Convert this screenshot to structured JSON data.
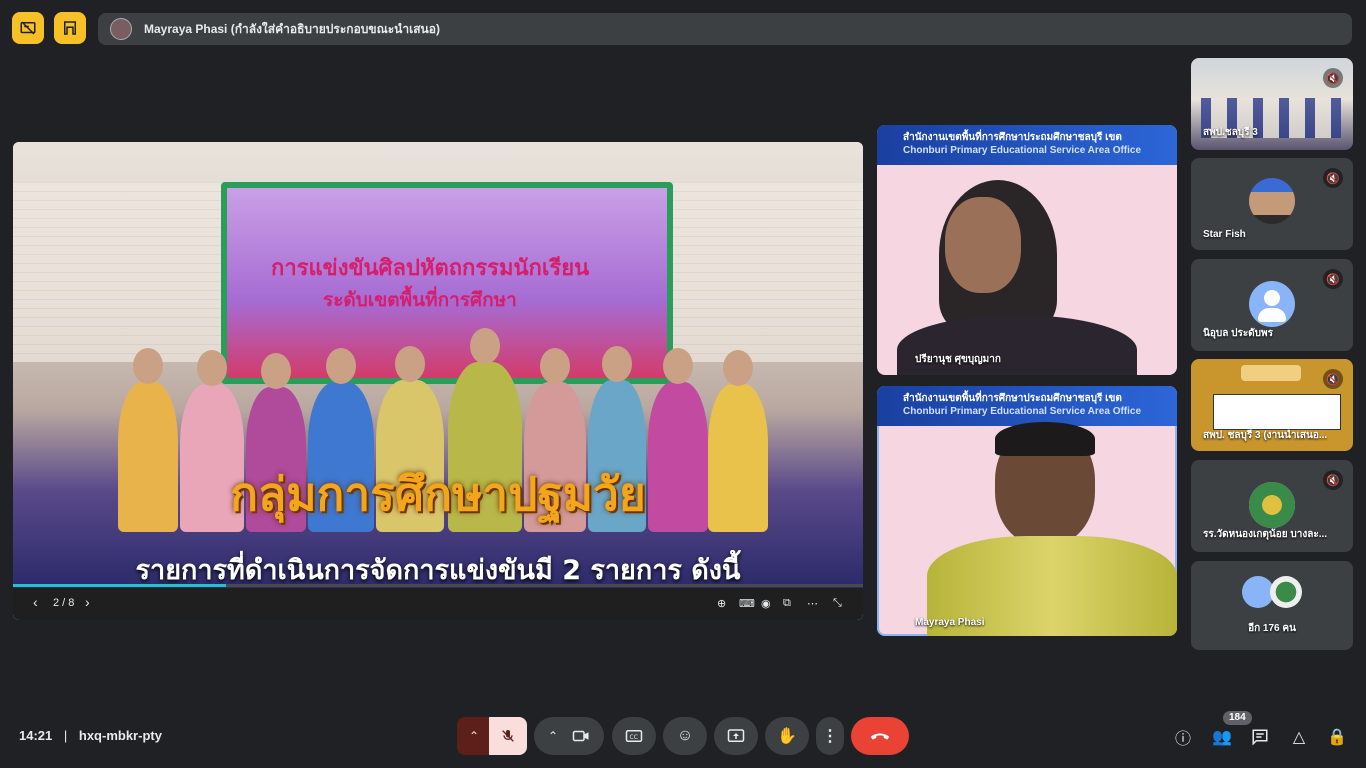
{
  "colors": {
    "accent": "#f6c026",
    "end_call": "#ea4335",
    "mic_off_bg": "#f9dedc",
    "tile_bg": "#3c4043",
    "page_bg": "#202124"
  },
  "top_bar": {
    "presenter_text": "Mayraya Phasi (กำลังใส่คำอธิบายประกอบขณะนำเสนอ)",
    "left_icons": [
      "present-stop-icon",
      "layout-icon"
    ]
  },
  "presentation": {
    "slide_banner_line1": "การแข่งขันศิลปหัตถกรรมนักเรียน",
    "slide_banner_line2": "ระดับเขตพื้นที่การศึกษา",
    "slide_headline": "กลุ่มการศึกษาปฐมวัย",
    "slide_subline": "รายการที่ดำเนินการจัดการแข่งขันมี 2 รายการ ดังนี้",
    "page_indicator": "2 / 8",
    "progress": 0.25
  },
  "video_tiles": {
    "header_line1": "สำนักงานเขตพื้นที่การศึกษาประถมศึกษาชลบุรี เขต",
    "header_line2": "Chonburi Primary Educational Service Area Office",
    "person1_name": "ปรียานุช ศุขบุญมาก",
    "person2_name": "Mayraya Phasi"
  },
  "participants": [
    {
      "name": "สพป.ชลบุรี 3",
      "type": "video"
    },
    {
      "name": "Star Fish",
      "type": "photo"
    },
    {
      "name": "นิอุบล ประดับพร",
      "type": "placeholder"
    },
    {
      "name": "สพป. ชลบุรี 3 (งานนำเสนอ...",
      "type": "presentation"
    },
    {
      "name": "รร.วัดหนองเกตุน้อย บางละ...",
      "type": "logo"
    },
    {
      "name": "อีก 176 คน",
      "type": "more"
    }
  ],
  "bottom_bar": {
    "time": "14:21",
    "separator": "|",
    "meeting_code": "hxq-mbkr-pty",
    "participant_count": "184"
  }
}
